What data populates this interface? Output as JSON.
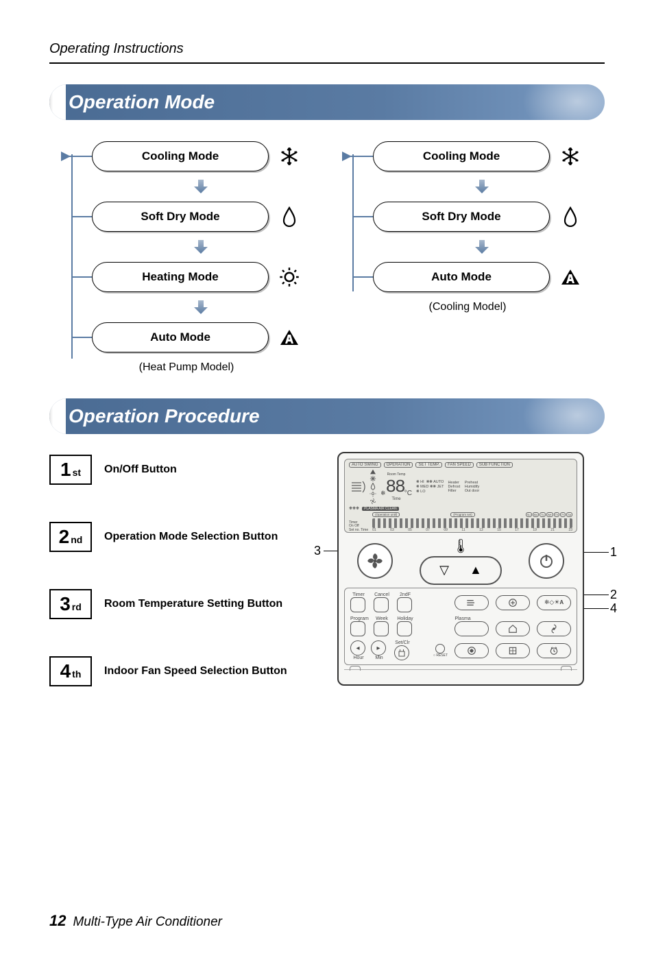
{
  "header": {
    "running_head": "Operating Instructions"
  },
  "sections": {
    "operation_mode": "Operation Mode",
    "operation_procedure": "Operation Procedure"
  },
  "mode_labels": {
    "cooling": "Cooling Mode",
    "soft_dry": "Soft Dry Mode",
    "heating": "Heating Mode",
    "auto": "Auto Mode"
  },
  "mode_icons": {
    "cooling": "snowflake-icon",
    "soft_dry": "droplet-icon",
    "heating": "sun-icon",
    "auto": "auto-triangle-icon"
  },
  "model_captions": {
    "heat_pump": "(Heat Pump Model)",
    "cooling": "(Cooling Model)"
  },
  "steps": [
    {
      "num": "1",
      "suffix": "st",
      "label": "On/Off Button"
    },
    {
      "num": "2",
      "suffix": "nd",
      "label": "Operation Mode Selection Button"
    },
    {
      "num": "3",
      "suffix": "rd",
      "label": "Room Temperature Setting Button"
    },
    {
      "num": "4",
      "suffix": "th",
      "label": "Indoor Fan Speed Selection Button"
    }
  ],
  "callouts": {
    "left": "3",
    "right_top": "1",
    "right_mid_a": "2",
    "right_mid_b": "4"
  },
  "remote": {
    "lcd_tags": [
      "AUTO SWING",
      "OPERATION",
      "SET TEMP.",
      "FAN SPEED",
      "SUB FUNCTION"
    ],
    "temp_display": "88",
    "temp_unit": "°C",
    "room_temp_label": "Room Temp",
    "fan_levels": [
      "HI",
      "MED",
      "LO"
    ],
    "fan_auto": "AUTO",
    "fan_jet": "JET",
    "sub_labels": [
      "Heater",
      "Preheat",
      "Defrost",
      "Humidify",
      "Filter",
      "Out door"
    ],
    "plasma_label": "PLASMA AIR CLEAN",
    "timer_labels": {
      "timer": "Timer",
      "on": "On",
      "off": "Off",
      "set_no": "Set no.",
      "time": "Time",
      "op_until": "(Operation until)",
      "prog_set": "(Program set)"
    },
    "timer_scale": [
      "01",
      "03",
      "05",
      "07",
      "09",
      "11",
      "13",
      "15",
      "17",
      "19",
      "21",
      "23"
    ],
    "day_tags": [
      "Su",
      "Mo",
      "Tu",
      "We",
      "Th",
      "Fr",
      "Sa"
    ],
    "panel": {
      "row1": [
        "Timer",
        "Cancel",
        "2ndF"
      ],
      "row2": [
        "Program",
        "Week",
        "Holiday"
      ],
      "row2_right": "Plasma",
      "row3_left": [
        "Hour",
        "Min"
      ],
      "row3_mid": "Set/Clr",
      "reset": "RESET"
    },
    "buttons": {
      "fan_speed": "fan-speed-button",
      "temp_down": "▽",
      "temp_up": "▲",
      "power": "power-button"
    }
  },
  "footer": {
    "page": "12",
    "title": "Multi-Type Air Conditioner"
  }
}
